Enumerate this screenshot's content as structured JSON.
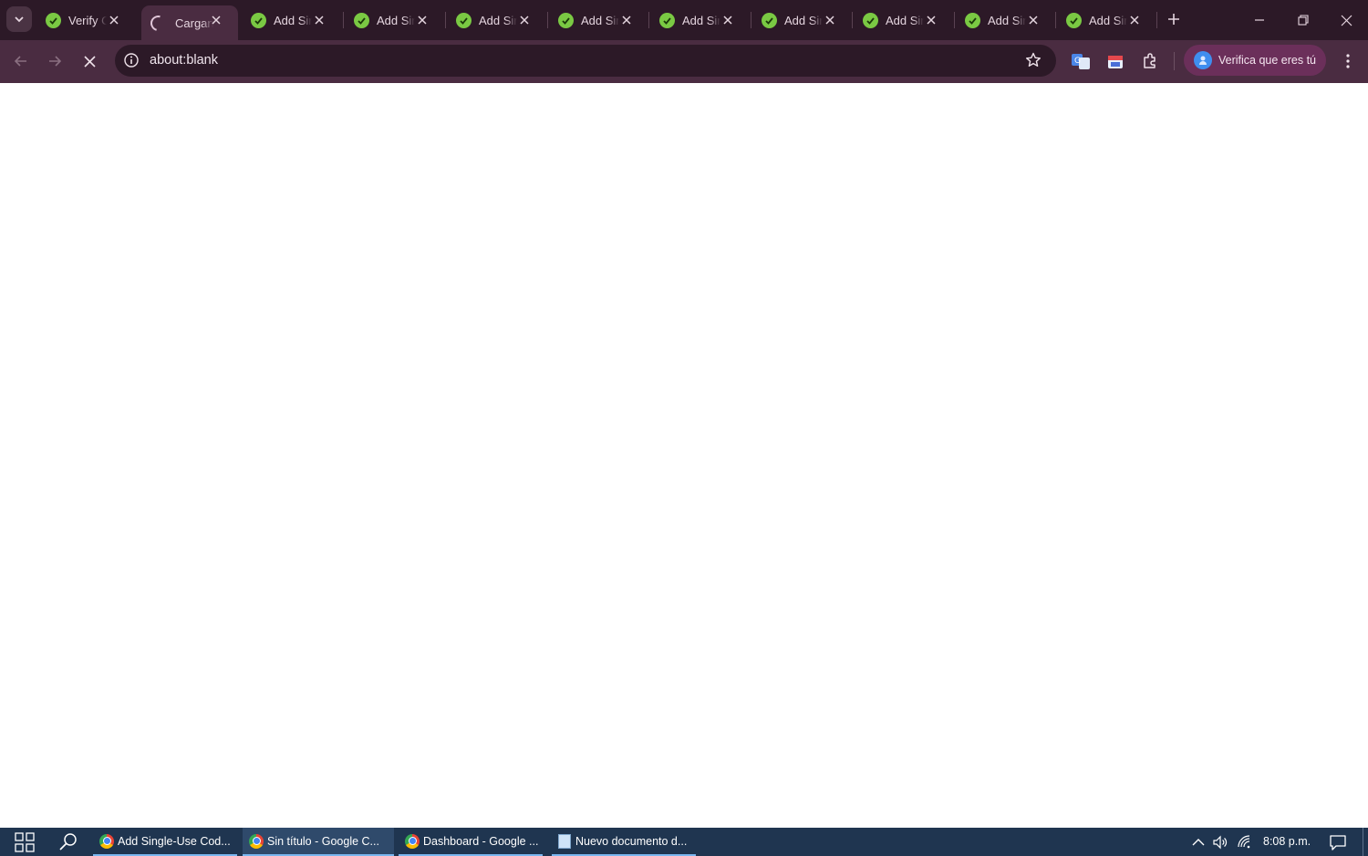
{
  "window": {
    "tab_strip": {
      "tabs": [
        {
          "title": "Verify Co",
          "state": "loaded",
          "icon": "green-check-favicon"
        },
        {
          "title": "Cargando",
          "state": "loading",
          "icon": "loading-spinner-icon",
          "active": true
        },
        {
          "title": "Add Single-Use",
          "state": "loaded",
          "icon": "green-check-favicon"
        },
        {
          "title": "Add Single-Use",
          "state": "loaded",
          "icon": "green-check-favicon"
        },
        {
          "title": "Add Single-Use",
          "state": "loaded",
          "icon": "green-check-favicon"
        },
        {
          "title": "Add Single-Use",
          "state": "loaded",
          "icon": "green-check-favicon"
        },
        {
          "title": "Add Single-Use",
          "state": "loaded",
          "icon": "green-check-favicon"
        },
        {
          "title": "Add Single-Use",
          "state": "loaded",
          "icon": "green-check-favicon"
        },
        {
          "title": "Add Single-Use",
          "state": "loaded",
          "icon": "green-check-favicon"
        },
        {
          "title": "Add Single-Use",
          "state": "loaded",
          "icon": "green-check-favicon"
        },
        {
          "title": "Add Single-Use",
          "state": "loaded",
          "icon": "green-check-favicon"
        }
      ]
    },
    "controls": [
      "minimize-icon",
      "restore-icon",
      "close-icon"
    ]
  },
  "toolbar": {
    "url": "about:blank",
    "profile_label": "Verifica que eres tú",
    "icons": [
      "back-arrow-icon",
      "forward-arrow-icon",
      "stop-loading-icon",
      "site-info-icon",
      "bookmark-star-icon",
      "translate-extension-icon",
      "calendar-extension-icon",
      "extensions-puzzle-icon",
      "profile-avatar-icon",
      "kebab-menu-icon"
    ]
  },
  "taskbar": {
    "items": [
      {
        "label": "Add Single-Use Cod...",
        "icon": "chrome-icon"
      },
      {
        "label": "Sin título - Google C...",
        "icon": "chrome-icon",
        "active": true
      },
      {
        "label": "Dashboard - Google ...",
        "icon": "chrome-icon"
      },
      {
        "label": "Nuevo documento d...",
        "icon": "notepad-icon"
      }
    ],
    "clock": "8:08 p.m."
  },
  "colors": {
    "tab_strip_bg": "#2c1927",
    "toolbar_bg": "#4a2c41",
    "profile_chip_bg": "#6b2f5a",
    "taskbar_bg": "#1f3550",
    "favicon_green": "#7ac943"
  }
}
